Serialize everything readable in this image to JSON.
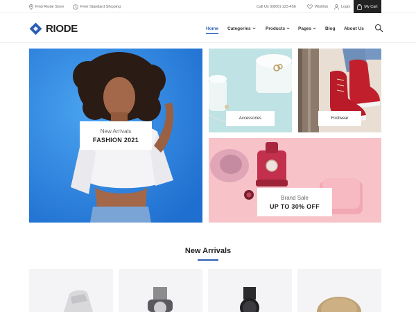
{
  "topbar": {
    "store": "Find Riode Store",
    "shipping": "Free Standard Shipping",
    "phone": "Call Us 0(800) 123-456",
    "wishlist": "Wishlist",
    "login": "Login",
    "cart": "My Cart"
  },
  "header": {
    "logo": "RIODE",
    "nav": [
      {
        "label": "Home"
      },
      {
        "label": "Categories"
      },
      {
        "label": "Products"
      },
      {
        "label": "Pages"
      },
      {
        "label": "Blog"
      },
      {
        "label": "About Us"
      }
    ]
  },
  "banners": {
    "main": {
      "subtitle": "New Arrivals",
      "title": "FASHION 2021"
    },
    "accessories": {
      "label": "Accessories"
    },
    "footwear": {
      "label": "Footwear"
    },
    "sale": {
      "subtitle": "Brand Sale",
      "title": "UP TO 30% OFF"
    }
  },
  "new_arrivals": {
    "title": "New Arrivals"
  },
  "colors": {
    "accent": "#2b5db5",
    "dark": "#222222",
    "main_banner_bg": "#2b84e3",
    "accessories_bg": "#bde0e3",
    "sale_bg": "#f6c0c6"
  }
}
